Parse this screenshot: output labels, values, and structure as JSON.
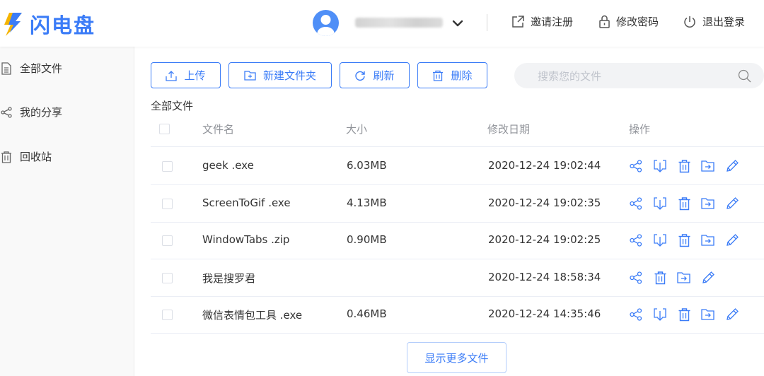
{
  "header": {
    "logo_text": "闪电盘",
    "register": "邀请注册",
    "change_password": "修改密码",
    "logout": "退出登录"
  },
  "sidebar": {
    "items": [
      {
        "label": "全部文件",
        "icon": "file-icon"
      },
      {
        "label": "我的分享",
        "icon": "share-icon"
      },
      {
        "label": "回收站",
        "icon": "trash-icon"
      }
    ]
  },
  "toolbar": {
    "upload": "上传",
    "new_folder": "新建文件夹",
    "refresh": "刷新",
    "delete": "删除",
    "search_placeholder": "搜索您的文件"
  },
  "breadcrumb": "全部文件",
  "table": {
    "columns": {
      "name": "文件名",
      "size": "大小",
      "modified": "修改日期",
      "actions": "操作"
    },
    "rows": [
      {
        "name": "geek .exe",
        "size": "6.03MB",
        "modified": "2020-12-24 19:02:44",
        "is_folder": false
      },
      {
        "name": "ScreenToGif .exe",
        "size": "4.13MB",
        "modified": "2020-12-24 19:02:35",
        "is_folder": false
      },
      {
        "name": "WindowTabs .zip",
        "size": "0.90MB",
        "modified": "2020-12-24 19:02:25",
        "is_folder": false
      },
      {
        "name": "我是搜罗君",
        "size": "",
        "modified": "2020-12-24 18:58:34",
        "is_folder": true
      },
      {
        "name": "微信表情包工具 .exe",
        "size": "0.46MB",
        "modified": "2020-12-24 14:35:46",
        "is_folder": false
      }
    ]
  },
  "more_button": "显示更多文件",
  "colors": {
    "accent": "#3b7cf7",
    "logo_bolt": "#f5b400"
  }
}
